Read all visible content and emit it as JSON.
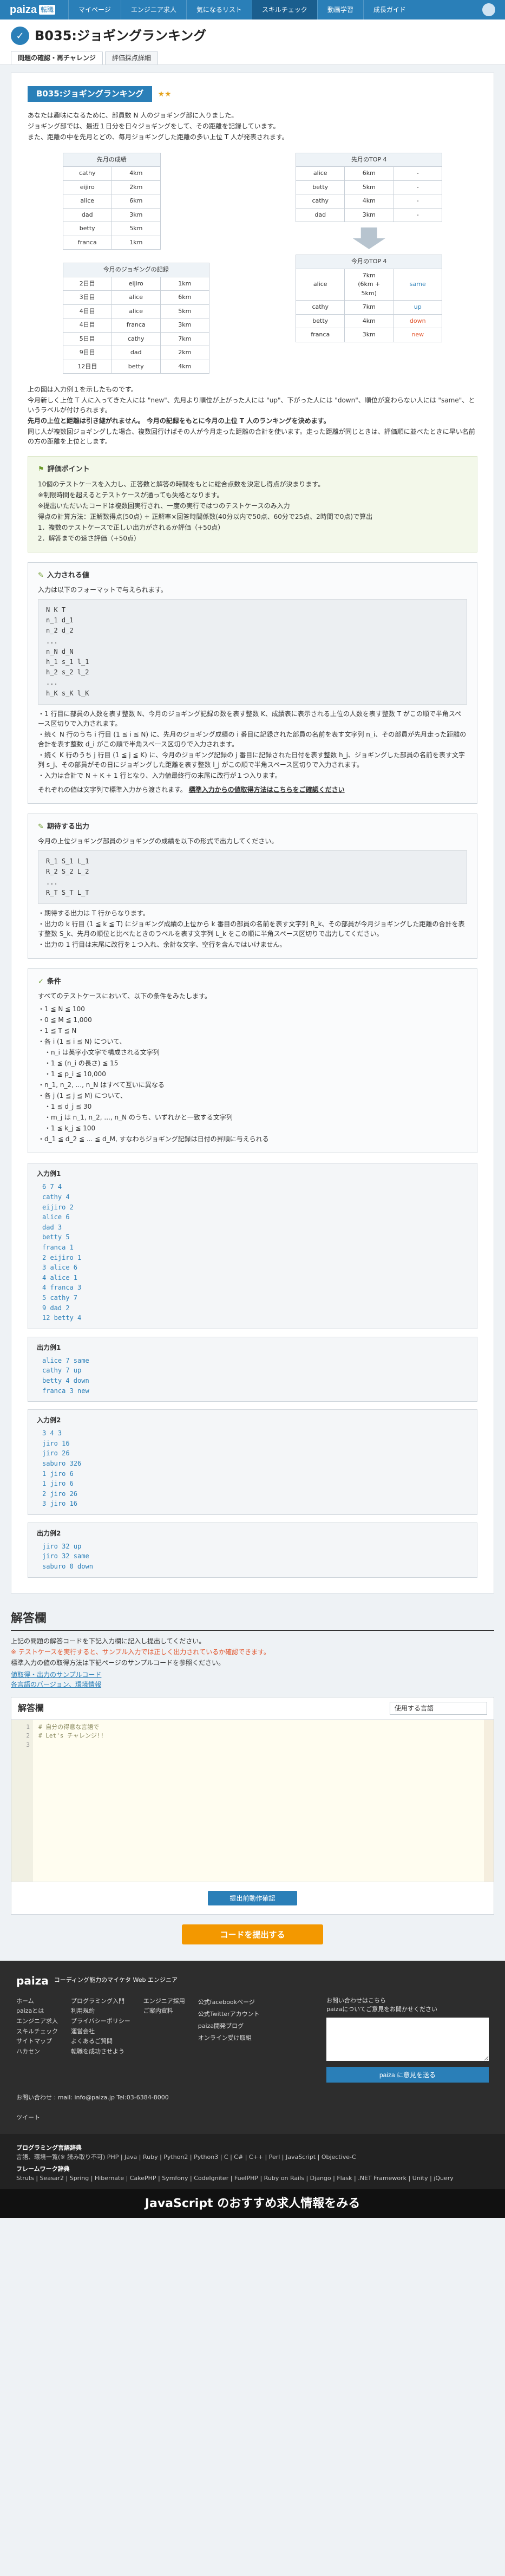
{
  "header": {
    "logo": "paiza",
    "logo_sub": "転職",
    "nav": [
      "マイページ",
      "エンジニア求人",
      "気になるリスト",
      "スキルチェック",
      "動画学習",
      "成長ガイド"
    ],
    "active_index": 3
  },
  "title": "B035:ジョギングランキング",
  "tabs": [
    "問題の確認・再チャレンジ",
    "評価採点詳細"
  ],
  "problem": {
    "label": "B035:ジョギングランキング",
    "stars": "★★",
    "intro": [
      "あなたは趣味になるために、部員数 N 人のジョギング部に入りました。",
      "ジョギング部では、最近１日分を日々ジョギングをして、その距離を記録しています。",
      "また、距離の中を先月とどの、毎月ジョギングした距離の多い上位 T 人が発表されます。"
    ],
    "left_table1": {
      "header": "先月の成績",
      "rows": [
        [
          "cathy",
          "4km"
        ],
        [
          "eijiro",
          "2km"
        ],
        [
          "alice",
          "6km"
        ],
        [
          "dad",
          "3km"
        ],
        [
          "betty",
          "5km"
        ],
        [
          "franca",
          "1km"
        ]
      ]
    },
    "right_table1": {
      "header": "先月のTOP 4",
      "rows": [
        [
          "alice",
          "6km",
          "-"
        ],
        [
          "betty",
          "5km",
          "-"
        ],
        [
          "cathy",
          "4km",
          "-"
        ],
        [
          "dad",
          "3km",
          "-"
        ]
      ]
    },
    "left_table2": {
      "header": "今月のジョギングの記録",
      "rows": [
        [
          "2日目",
          "eijiro",
          "1km"
        ],
        [
          "3日目",
          "alice",
          "6km"
        ],
        [
          "4日目",
          "alice",
          "5km"
        ],
        [
          "4日目",
          "franca",
          "3km"
        ],
        [
          "5日目",
          "cathy",
          "7km"
        ],
        [
          "9日目",
          "dad",
          "2km"
        ],
        [
          "12日目",
          "betty",
          "4km"
        ]
      ]
    },
    "right_table2": {
      "header": "今月のTOP 4",
      "rows": [
        [
          "alice",
          "7km\n(6km + 5km)",
          "same"
        ],
        [
          "cathy",
          "7km",
          "up"
        ],
        [
          "betty",
          "4km",
          "down"
        ],
        [
          "franca",
          "3km",
          "new"
        ]
      ]
    },
    "body": [
      "上の図は入力例１を示したものです。",
      "今月新しく上位 T 人に入ってきた人には \"new\"、先月より順位が上がった人には \"up\"、下がった人には \"down\"、順位が変わらない人には \"same\"、というラベルが付けられます。",
      "先月の上位と距離は引き継がれません。 今月の記録をもとに今月の上位 T 人のランキングを決めます。",
      "同じ人が複数回ジョギングした場合、複数回行けばその人が今月走った距離の合計を使います。走った距離が同じときは、評価順に並べたときに早い名前の方の距離を上位とします。"
    ],
    "eval": {
      "title": "評価ポイント",
      "lines": [
        "10個のテストケースを入力し、正答数と解答の時間をもとに総合点数を決定し得点が決まります。",
        "※制限時間を超えるとテストケースが通っても失格となります。",
        "※提出いただいたコードは複数回実行され、一度の実行ではつのテストケースのみ入力",
        "得点の計算方法：正解数得点(50点) + 正解率×回答時間係数(40分以内で50点、60分で25点、2時間で0点)で算出",
        "1．複数のテストケースで正しい出力がされるか評価（+50点）",
        "2．解答までの速さ評価（+50点）"
      ]
    },
    "input": {
      "title": "入力される値",
      "desc": "入力は以下のフォーマットで与えられます。",
      "format": "N K T\nn_1 d_1\nn_2 d_2\n...\nn_N d_N\nh_1 s_1 l_1\nh_2 s_2 l_2\n...\nh_K s_K l_K",
      "notes": [
        "・1 行目に部員の人数を表す整数 N、今月のジョギング記録の数を表す整数 K、成績表に表示される上位の人数を表す整数 T がこの順で半角スペース区切りで入力されます。",
        "・続く N 行のうち i 行目 (1 ≦ i ≦ N) に、先月のジョギング成績の i 番目に記録された部員の名前を表す文字列 n_i、その部員が先月走った距離の合計を表す整数 d_i がこの順で半角スペース区切りで入力されます。",
        "・続く K 行のうち j 行目 (1 ≦ j ≦ K) に、今月のジョギング記録の j 番目に記録された日付を表す整数 h_j、ジョギングした部員の名前を表す文字列 s_j、その部員がその日にジョギングした距離を表す整数 l_j がこの順で半角スペース区切りで入力されます。",
        "・入力は合計で N + K + 1 行となり、入力値最終行の末尾に改行が１つ入ります。"
      ],
      "link_prefix": "それぞれの値は文字列で標準入力から渡されます。",
      "link": "標準入力からの値取得方法はこちらをご確認ください"
    },
    "output": {
      "title": "期待する出力",
      "desc": "今月の上位ジョギング部員のジョギングの成績を以下の形式で出力してください。",
      "format": "R_1 S_1 L_1\nR_2 S_2 L_2\n...\nR_T S_T L_T",
      "notes": [
        "・期待する出力は T 行からなります。",
        "・出力の k 行目 (1 ≦ k ≦ T) にジョギング成績の上位から k 番目の部員の名前を表す文字列 R_k、その部員が今月ジョギングした距離の合計を表す整数 S_k、先月の順位と比べたときのラベルを表す文字列 L_k をこの順に半角スペース区切りで出力してください。",
        "・出力の 1 行目は末尾に改行を１つ入れ、余計な文字、空行を含んではいけません。"
      ]
    },
    "conditions": {
      "title": "条件",
      "desc": "すべてのテストケースにおいて、以下の条件をみたします。",
      "items": [
        "・1 ≦ N ≦ 100",
        "・0 ≦ M ≦ 1,000",
        "・1 ≦ T ≦ N",
        "・各 i (1 ≦ i ≦ N) について、",
        "　・n_i は英字小文字で構成される文字列",
        "　・1 ≦ (n_i の長さ) ≦ 15",
        "　・1 ≦ p_i ≦ 10,000",
        "・n_1, n_2, ..., n_N はすべて互いに異なる",
        "・各 j (1 ≦ j ≦ M) について、",
        "　・1 ≦ d_j ≦ 30",
        "　・m_j は n_1, n_2, ..., n_N のうち、いずれかと一致する文字列",
        "　・1 ≦ k_j ≦ 100",
        "・d_1 ≦ d_2 ≦ ... ≦ d_M, すなわちジョギング記録は日付の昇順に与えられる"
      ]
    },
    "samples": [
      {
        "label": "入力例1",
        "text": "6 7 4\ncathy 4\neijiro 2\nalice 6\ndad 3\nbetty 5\nfranca 1\n2 eijiro 1\n3 alice 6\n4 alice 1\n4 franca 3\n5 cathy 7\n9 dad 2\n12 betty 4"
      },
      {
        "label": "出力例1",
        "text": "alice 7 same\ncathy 7 up\nbetty 4 down\nfranca 3 new"
      },
      {
        "label": "入力例2",
        "text": "3 4 3\njiro 16\njiro 26\nsaburo 326\n1 jiro 6\n1 jiro 6\n2 jiro 26\n3 jiro 16"
      },
      {
        "label": "出力例2",
        "text": "jiro 32 up\njiro 32 same\nsaburo 0 down"
      }
    ]
  },
  "answer": {
    "heading": "解答欄",
    "intro": [
      "上記の問題の解答コードを下記入力欄に記入し提出してください。",
      "※ テストケースを実行すると、サンプル入力では正しく出力されているか確認できます。",
      "標準入力の値の取得方法は下記ページのサンプルコードを参照ください。"
    ],
    "links": [
      "値取得・出力のサンプルコード",
      "各言語のバージョン、環境情報"
    ],
    "editor_label": "解答欄",
    "language": "使用する言語",
    "code_lines": [
      "1",
      "2",
      "3"
    ],
    "code": "# 自分の得意な言語で\n# Let's チャレンジ!!",
    "run_button": "提出前動作確認",
    "submit_button": "コードを提出する"
  },
  "footer": {
    "tagline": "コーディング能力のマイケタ Web エンジニア",
    "col1": [
      "ホーム",
      "paizaとは",
      "エンジニア求人",
      "スキルチェック",
      "サイトマップ",
      "ハカセン"
    ],
    "col2": [
      "プログラミング入門",
      "利用規約",
      "プライバシーポリシー",
      "運営会社",
      "よくあるご質問",
      "転職を成功させよう"
    ],
    "col3": [
      "エンジニア採用",
      "ご案内資料"
    ],
    "social": [
      "公式facebookページ",
      "公式Twitterアカウント",
      "paiza開発ブログ",
      "オンライン受け取組"
    ],
    "feedback_title": "お問い合わせはこちら",
    "feedback_prompt": "paizaについてご意見をお聞かせください",
    "feedback_button": "paiza に意見を送る",
    "contact": "お問い合わせ : mail: info@paiza.jp  Tel:03-6384-8000",
    "tweet": "ツイート",
    "langs_title": "プログラミング言語辞典",
    "langs": "言語、環境一覧(※ 読み取り不可) PHP | Java | Ruby | Python2 | Python3 | C | C# | C++ | Perl | JavaScript | Objective-C",
    "fw_title": "フレームワーク辞典",
    "fws": "Struts | Seasar2 | Spring | Hibernate | CakePHP | Symfony | CodeIgniter | FuelPHP | Ruby on Rails | Django | Flask | .NET Framework | Unity | jQuery",
    "banner": "JavaScript のおすすめ求人情報をみる"
  }
}
